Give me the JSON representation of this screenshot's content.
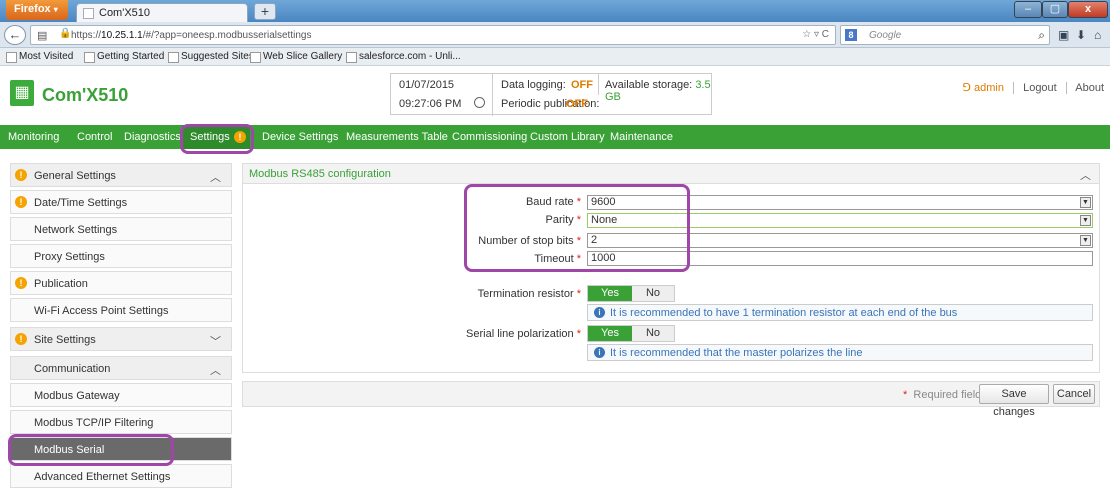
{
  "browser": {
    "menu_label": "Firefox",
    "tab_title": "Com'X510",
    "new_tab": "+",
    "url_prefix": "https://",
    "url_host": "10.25.1.1",
    "url_path": "/#/?app=oneesp.modbusserialsettings",
    "search_placeholder": "Google",
    "bookmarks": [
      "Most Visited",
      "Getting Started",
      "Suggested Sites",
      "Web Slice Gallery",
      "salesforce.com - Unli..."
    ]
  },
  "header": {
    "app_name": "Com'X510",
    "date": "01/07/2015",
    "time": "09:27:06 PM",
    "data_logging_label": "Data logging:",
    "data_logging_value": "OFF",
    "periodic_publication_label": "Periodic publication:",
    "periodic_publication_value": "OFF",
    "storage_label": "Available storage:",
    "storage_value": "3.5 GB",
    "user": "admin",
    "logout": "Logout",
    "about": "About"
  },
  "menu": [
    "Monitoring",
    "Control",
    "Diagnostics",
    "Settings",
    "Device Settings",
    "Measurements Table",
    "Commissioning",
    "Custom Library",
    "Maintenance"
  ],
  "sidebar": {
    "items": [
      {
        "label": "General Settings"
      },
      {
        "label": "Date/Time Settings"
      },
      {
        "label": "Network Settings"
      },
      {
        "label": "Proxy Settings"
      },
      {
        "label": "Publication"
      },
      {
        "label": "Wi-Fi Access Point Settings"
      },
      {
        "label": "Site Settings"
      },
      {
        "label": "Communication"
      },
      {
        "label": "Modbus Gateway"
      },
      {
        "label": "Modbus TCP/IP Filtering"
      },
      {
        "label": "Modbus Serial"
      },
      {
        "label": "Advanced Ethernet Settings"
      }
    ]
  },
  "panel": {
    "title": "Modbus RS485 configuration",
    "baud_label": "Baud rate",
    "baud_value": "9600",
    "parity_label": "Parity",
    "parity_value": "None",
    "stopbits_label": "Number of stop bits",
    "stopbits_value": "2",
    "timeout_label": "Timeout",
    "timeout_value": "1000",
    "termination_label": "Termination resistor",
    "termination_hint": "It is recommended to have 1 termination resistor at each end of the bus",
    "polarization_label": "Serial line polarization",
    "polarization_hint": "It is recommended that the master polarizes the line",
    "yes": "Yes",
    "no": "No",
    "required_star": "*"
  },
  "footer": {
    "required_note": "Required field",
    "save": "Save changes",
    "cancel": "Cancel"
  },
  "colors": {
    "brand_green": "#3aa137",
    "warning_orange": "#f5a300",
    "annotation_purple": "#a046a8"
  }
}
